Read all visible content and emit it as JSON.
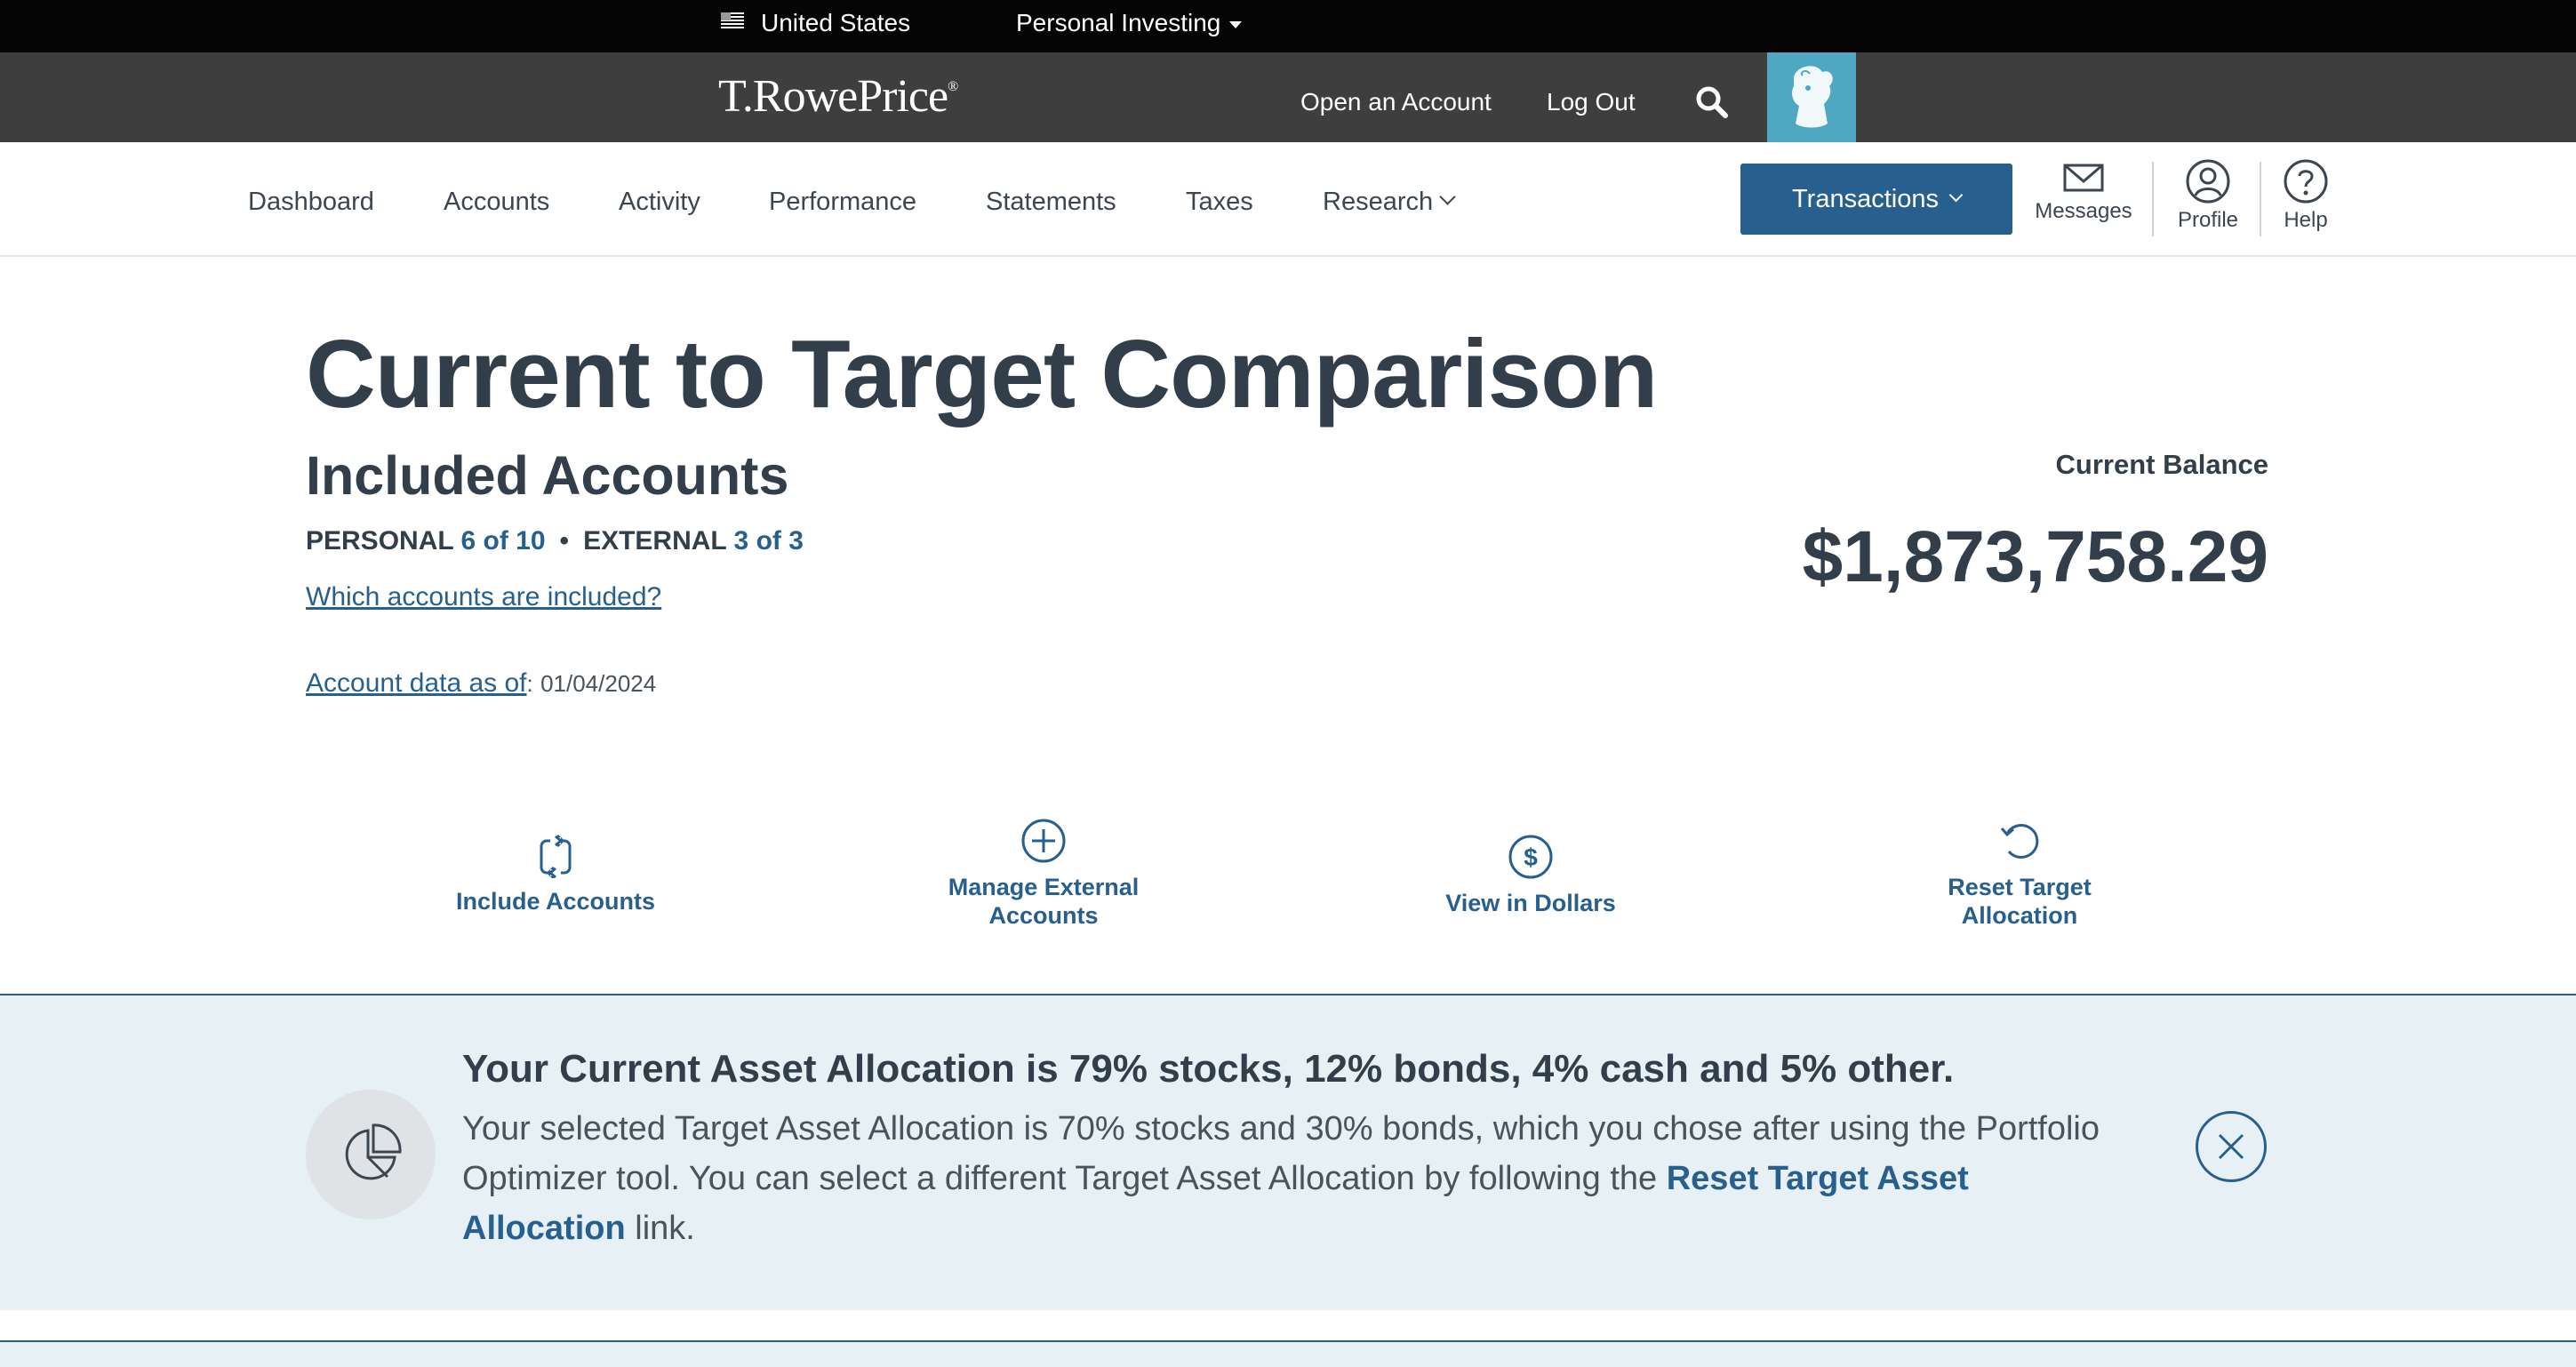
{
  "utility_bar": {
    "country": "United States",
    "segment": "Personal Investing"
  },
  "brand": {
    "logo_text": "T.RowePrice",
    "logo_mark": "®",
    "open_account": "Open an Account",
    "log_out": "Log Out"
  },
  "nav": {
    "items": [
      "Dashboard",
      "Accounts",
      "Activity",
      "Performance",
      "Statements",
      "Taxes",
      "Research"
    ],
    "transactions": "Transactions",
    "messages": "Messages",
    "profile": "Profile",
    "help": "Help"
  },
  "main": {
    "title": "Current to Target Comparison",
    "section_title": "Included Accounts",
    "personal_label": "PERSONAL",
    "personal_count": "6 of 10",
    "separator": "•",
    "external_label": "EXTERNAL",
    "external_count": "3 of 3",
    "which_link": "Which accounts are included?",
    "asof_link": "Account data as of",
    "asof_colon": ":",
    "asof_date": "01/04/2024",
    "balance_label": "Current Balance",
    "balance_value": "$1,873,758.29"
  },
  "actions": {
    "include": "Include Accounts",
    "manage_line1": "Manage External",
    "manage_line2": "Accounts",
    "view_dollars": "View in Dollars",
    "reset_line1": "Reset Target",
    "reset_line2": "Allocation"
  },
  "banner": {
    "heading": "Your Current Asset Allocation is 79% stocks, 12% bonds, 4% cash and 5% other.",
    "text_before": "Your selected Target Asset Allocation is 70% stocks and 30% bonds, which you chose after using the Portfolio Optimizer tool. You can select a different Target Asset Allocation by following the ",
    "text_link": "Reset Target Asset Allocation",
    "text_after": " link."
  },
  "colors": {
    "primary_blue": "#27608f",
    "header_dark": "#3e3e3e",
    "banner_bg": "#e7f0f5",
    "logo_teal": "#4ea8c2"
  }
}
